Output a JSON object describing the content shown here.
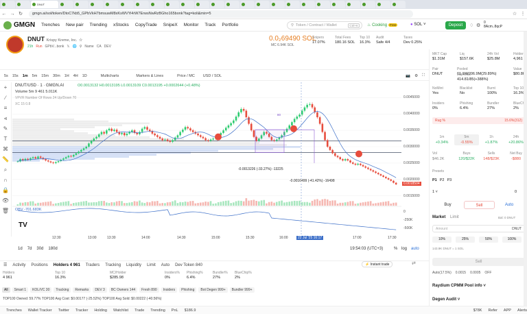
{
  "browser": {
    "active_tab": "DNUT",
    "url": "gmgn.ai/sol/token/DtoC7kb5_GPbVkH7bmsuwM8xKsWVYi4rW7ErwsNwRzBGho165bonk?tag=koli&min=5"
  },
  "nav": {
    "logo": "GMGN",
    "links": [
      "Trenches",
      "New pair",
      "Trending",
      "xStocks",
      "CopyTrade",
      "SnipeX",
      "Monitor",
      "Track",
      "Portfolio"
    ],
    "search_placeholder": "Token / Contract / Wallet",
    "search_kbd": "Ctrl+K",
    "cooking": "Cooking",
    "cooking_badge": "Free",
    "chain": "SOL",
    "deposit": "Deposit",
    "wallet_balance": "0",
    "wallet_addr": "8Acm..8qcP"
  },
  "token": {
    "symbol": "DNUT",
    "fullname": "Krispy Kreme, Inc.",
    "age": "21h",
    "tag": "Run",
    "creator": "GPbV...bonk",
    "links": [
      "Name",
      "CA",
      "DEV"
    ],
    "price": "0.0₂69490 SOL",
    "mc": "MC 6.94K SOL",
    "stats": [
      {
        "label": "Snipers",
        "value": "17.07%"
      },
      {
        "label": "Total Fees",
        "value": "180.16 SOL"
      },
      {
        "label": "Top 10",
        "value": "16.3%"
      },
      {
        "label": "Audit",
        "value": "Safe 4/4"
      },
      {
        "label": "Taxes",
        "value": "Dev 0.25%"
      }
    ]
  },
  "chart_toolbar": {
    "intervals": [
      "5s",
      "15s",
      "1m",
      "5m",
      "15m",
      "30m",
      "1H",
      "4H",
      "1D"
    ],
    "active_interval": "1m",
    "tools": [
      "Multicharts",
      "Markers & Lines",
      "Price / MC",
      "USD / SOL"
    ]
  },
  "chart_legend": {
    "title": "DNUT/USD · 1 · GMGN.AI",
    "ohlc": "O0.0013132 H0.0013195 L0.0013109 C0.0013195 +0.0002644 (+0.48%)",
    "volume": "Volume  5m 9  461  5.011K",
    "vpvr": "VPVR Number Of Rows 24 Up/Down 70",
    "xc": "XC 15 0.8",
    "obv": "OBV  -701.683K",
    "measure1": "-0.0013226 (-33.27%) -13225",
    "measure2": "-0.0016499 (-41.42%) -16498",
    "measure_top": "80"
  },
  "chart_data": {
    "type": "candlestick",
    "x_ticks": [
      "12:30",
      "13:00",
      "13:30",
      "14:00",
      "14:30",
      "15:00",
      "15:30",
      "16:00",
      "22 Jul '25  16:17",
      "17:00",
      "17:30"
    ],
    "y_ticks": [
      "0.0045000",
      "0.0040000",
      "0.0035000",
      "0.0030000",
      "0.0025000",
      "0.0020000",
      "0.0015000"
    ],
    "current_price": "0.0018504",
    "obv_ticks": [
      "0",
      "-250K",
      "-500K"
    ],
    "close": [
      0.00255,
      0.00262,
      0.00258,
      0.00263,
      0.0026,
      0.00265,
      0.00268,
      0.00264,
      0.0027,
      0.00266,
      0.00262,
      0.00258,
      0.00255,
      0.00252,
      0.0025,
      0.00253,
      0.00256,
      0.0026,
      0.00264,
      0.00268,
      0.00272,
      0.0027,
      0.00275,
      0.0028,
      0.00285,
      0.0029,
      0.00295,
      0.003,
      0.0031,
      0.00318,
      0.00325,
      0.0033,
      0.00338,
      0.00345,
      0.0034,
      0.0035,
      0.00355,
      0.00348,
      0.00352,
      0.00345,
      0.00338,
      0.00342,
      0.00335,
      0.0034,
      0.00345,
      0.0035,
      0.00342,
      0.00338,
      0.00345,
      0.00355,
      0.0036,
      0.00352,
      0.00348,
      0.0034,
      0.00335,
      0.0033,
      0.00325,
      0.0032,
      0.00322,
      0.00318,
      0.00315,
      0.0032,
      0.00328,
      0.00335,
      0.00345,
      0.00352,
      0.0036,
      0.00356,
      0.0035,
      0.00345,
      0.0034,
      0.00335,
      0.0033,
      0.00326,
      0.0032,
      0.00318,
      0.00322,
      0.00325,
      0.00328,
      0.00335,
      0.00342,
      0.0035,
      0.00358,
      0.00365,
      0.00372,
      0.0038,
      0.00392,
      0.00405,
      0.00415,
      0.0041,
      0.0039,
      0.0037,
      0.0035,
      0.0033,
      0.00318,
      0.00325,
      0.00335,
      0.00345,
      0.0034,
      0.0033,
      0.0032,
      0.00318,
      0.00322,
      0.00328,
      0.00335,
      0.00345,
      0.00355,
      0.00365,
      0.00375,
      0.00385,
      0.00392,
      0.00398,
      0.0041,
      0.0042,
      0.00428,
      0.0043,
      0.0042,
      0.00405,
      0.0039,
      0.0037,
      0.00345,
      0.0032,
      0.003,
      0.0029,
      0.0028,
      0.00272,
      0.00268,
      0.00262,
      0.00258,
      0.00262,
      0.00258,
      0.00252,
      0.00248,
      0.00245,
      0.00248,
      0.00244,
      0.0024,
      0.00236,
      0.00232,
      0.00228,
      0.00224,
      0.0022,
      0.00216,
      0.00212,
      0.00208,
      0.00204,
      0.002,
      0.00196,
      0.0019,
      0.00185
    ]
  },
  "chart_footer": {
    "ranges": [
      "1d",
      "7d",
      "30d",
      "180d"
    ],
    "clock": "19:54:03 (UTC+3)",
    "modes": [
      "%",
      "log",
      "auto"
    ]
  },
  "bottom_tabs": [
    "Activity",
    "Positions",
    "Holders 4 961",
    "Traders",
    "Tracking",
    "Liquidity",
    "Limit",
    "Auto",
    "Dev Token 840"
  ],
  "instant_trade": "Instant trade",
  "holders_stats": [
    {
      "label": "Holders",
      "value": "4 961"
    },
    {
      "label": "Top 10",
      "value": "16.3%"
    },
    {
      "label": "MC/Holder",
      "value": "$285.98"
    },
    {
      "label": "Insiders%",
      "value": "0%"
    },
    {
      "label": "Phishing%",
      "value": "6.4%"
    },
    {
      "label": "Bundler%",
      "value": "27%"
    },
    {
      "label": "BlueChip%",
      "value": "2%"
    }
  ],
  "filters": [
    "All",
    "Smart 1",
    "KOL/VC 30",
    "Tracking",
    "Remarks",
    "DEV 3",
    "BC Owners 144",
    "Fresh 890",
    "Insiders",
    "Phishing",
    "Bot Degen 999+",
    "Bundler 999+"
  ],
  "top100": "TOP100 Owned: 59.77%   TOP100 Avg Cost: $0.00177 (-25.52%)   TOP100 Avg Sold: $0.00222 (-40.56%)",
  "statusbar": [
    "Trenches",
    "Wallet Tracker",
    "Twitter",
    "Tracker",
    "Holding",
    "Watchlist",
    "Trade",
    "Trending",
    "PnL",
    "$186.9",
    "$78K",
    "Refer",
    "APP",
    "Alerts"
  ],
  "right": {
    "top": [
      {
        "label": "MKT Cap",
        "value": "$1.31M"
      },
      {
        "label": "Liq",
        "value": "$157.6K"
      },
      {
        "label": "24h Vol",
        "value": "$25.8M"
      },
      {
        "label": "Holders",
        "value": "4,961"
      }
    ],
    "pair_rows": [
      {
        "label": "Pair",
        "value": "DNUT"
      },
      {
        "label": "Pooled",
        "value": "61.1M/206.9M(29.89%)"
      },
      {
        "label": "Liq/Initial",
        "value": "414.81/85(+388%)"
      },
      {
        "label": "Value",
        "value": "$80.8K"
      }
    ],
    "sec": [
      {
        "label": "NoMint",
        "value": "Yes"
      },
      {
        "label": "Blacklist",
        "value": "No"
      },
      {
        "label": "Burnt",
        "value": "100%"
      },
      {
        "label": "Top 10",
        "value": "16.3%"
      }
    ],
    "sec2": [
      {
        "label": "Insiders",
        "value": "0%"
      },
      {
        "label": "Phishing",
        "value": "6.4%"
      },
      {
        "label": "Bundler",
        "value": "27%"
      },
      {
        "label": "BlueChip",
        "value": "2%"
      }
    ],
    "rug": "Rug %",
    "rug_value": "15.6%(312)",
    "tf": [
      {
        "label": "1m",
        "value": "+0.34%"
      },
      {
        "label": "5m",
        "value": "-0.55%"
      },
      {
        "label": "1h",
        "value": "+1.87%"
      },
      {
        "label": "24h",
        "value": "+20.86%"
      }
    ],
    "flow": [
      {
        "label": "Vol",
        "value": "$46.2K"
      },
      {
        "label": "Buys",
        "value": "120/$22K"
      },
      {
        "label": "Sells",
        "value": "148/$23K"
      },
      {
        "label": "Net Buy",
        "value": "-$880"
      }
    ],
    "presets": "Presets",
    "preset_tabs": [
      "P1",
      "P2",
      "P3"
    ],
    "buy": "Buy",
    "sell": "Sell",
    "auto": "Auto",
    "market": "Market",
    "limit": "Limit",
    "bal": "Bal: 0 DNUT",
    "amount": "Amount",
    "unit": "DNUT",
    "pcts": [
      "10%",
      "25%",
      "50%",
      "100%"
    ],
    "quote": "143.9K DNUT = 1 SOL",
    "sell_btn": "Sell",
    "settings": [
      "Auto(17.5%)",
      "0.0015",
      "0.0005",
      "OFF"
    ],
    "pool_info": "Raydium CPMM Pool info",
    "degen_audit": "Degen Audit"
  }
}
